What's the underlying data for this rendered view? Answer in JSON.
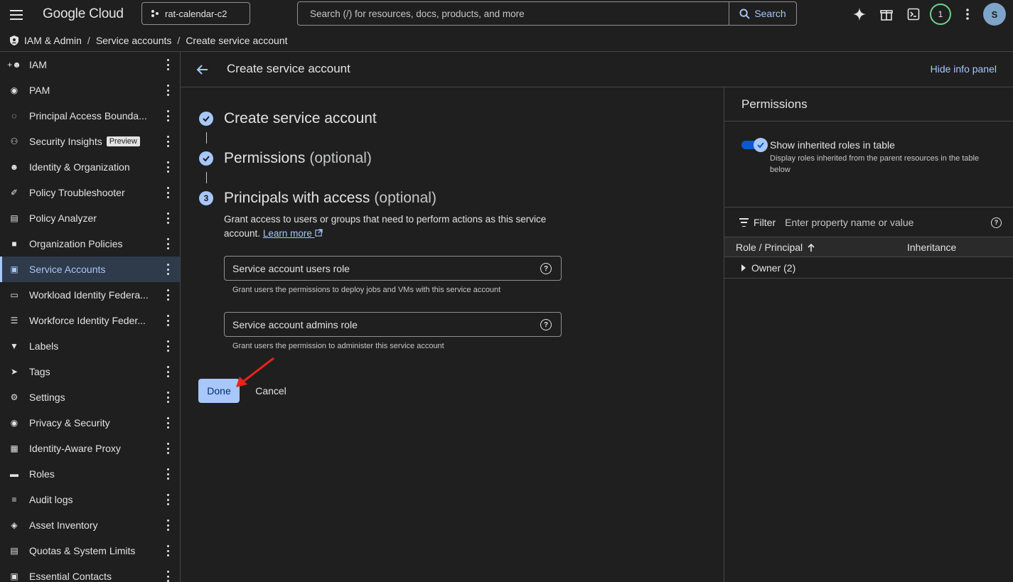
{
  "topbar": {
    "brand": "Google Cloud",
    "project": "rat-calendar-c2",
    "search_placeholder": "Search (/) for resources, docs, products, and more",
    "search_button": "Search",
    "notification_count": "1",
    "avatar_letter": "S"
  },
  "breadcrumb": {
    "items": [
      "IAM & Admin",
      "Service accounts",
      "Create service account"
    ],
    "separator": "/"
  },
  "sidebar": {
    "items": [
      {
        "label": "IAM",
        "icon": "add-person-icon"
      },
      {
        "label": "PAM",
        "icon": "shield-icon"
      },
      {
        "label": "Principal Access Bounda...",
        "icon": "boundary-icon"
      },
      {
        "label": "Security Insights",
        "icon": "insights-icon",
        "chip": "Preview"
      },
      {
        "label": "Identity & Organization",
        "icon": "account-circle-icon"
      },
      {
        "label": "Policy Troubleshooter",
        "icon": "wrench-icon"
      },
      {
        "label": "Policy Analyzer",
        "icon": "analyzer-icon"
      },
      {
        "label": "Organization Policies",
        "icon": "policy-doc-icon"
      },
      {
        "label": "Service Accounts",
        "icon": "service-account-icon",
        "active": true
      },
      {
        "label": "Workload Identity Federa...",
        "icon": "id-card-icon"
      },
      {
        "label": "Workforce Identity Feder...",
        "icon": "list-icon"
      },
      {
        "label": "Labels",
        "icon": "label-icon"
      },
      {
        "label": "Tags",
        "icon": "tag-icon"
      },
      {
        "label": "Settings",
        "icon": "settings-icon"
      },
      {
        "label": "Privacy & Security",
        "icon": "privacy-shield-icon"
      },
      {
        "label": "Identity-Aware Proxy",
        "icon": "proxy-icon"
      },
      {
        "label": "Roles",
        "icon": "roles-icon"
      },
      {
        "label": "Audit logs",
        "icon": "audit-logs-icon"
      },
      {
        "label": "Asset Inventory",
        "icon": "asset-icon"
      },
      {
        "label": "Quotas & System Limits",
        "icon": "quota-icon"
      },
      {
        "label": "Essential Contacts",
        "icon": "contacts-icon"
      }
    ]
  },
  "page": {
    "title": "Create service account",
    "hide_info_panel": "Hide info panel"
  },
  "steps": {
    "step1_title": "Create service account",
    "step2_title": "Permissions",
    "step2_optional": "(optional)",
    "step3_number": "3",
    "step3_title": "Principals with access",
    "step3_optional": "(optional)",
    "description": "Grant access to users or groups that need to perform actions as this service account.",
    "learn_more": "Learn more"
  },
  "fields": {
    "users_role_placeholder": "Service account users role",
    "users_role_hint": "Grant users the permissions to deploy jobs and VMs with this service account",
    "admins_role_placeholder": "Service account admins role",
    "admins_role_hint": "Grant users the permission to administer this service account"
  },
  "actions": {
    "done": "Done",
    "cancel": "Cancel"
  },
  "panel": {
    "title": "Permissions",
    "toggle_label": "Show inherited roles in table",
    "toggle_desc": "Display roles inherited from the parent resources in the table below",
    "toggle_on": true,
    "filter_label": "Filter",
    "filter_placeholder": "Enter property name or value",
    "col_role": "Role / Principal",
    "col_inheritance": "Inheritance",
    "rows": [
      {
        "label": "Owner (2)"
      }
    ]
  },
  "colors": {
    "accent": "#a8c7fa",
    "background": "#1f1f1f",
    "annotation_arrow": "#e8231b"
  }
}
